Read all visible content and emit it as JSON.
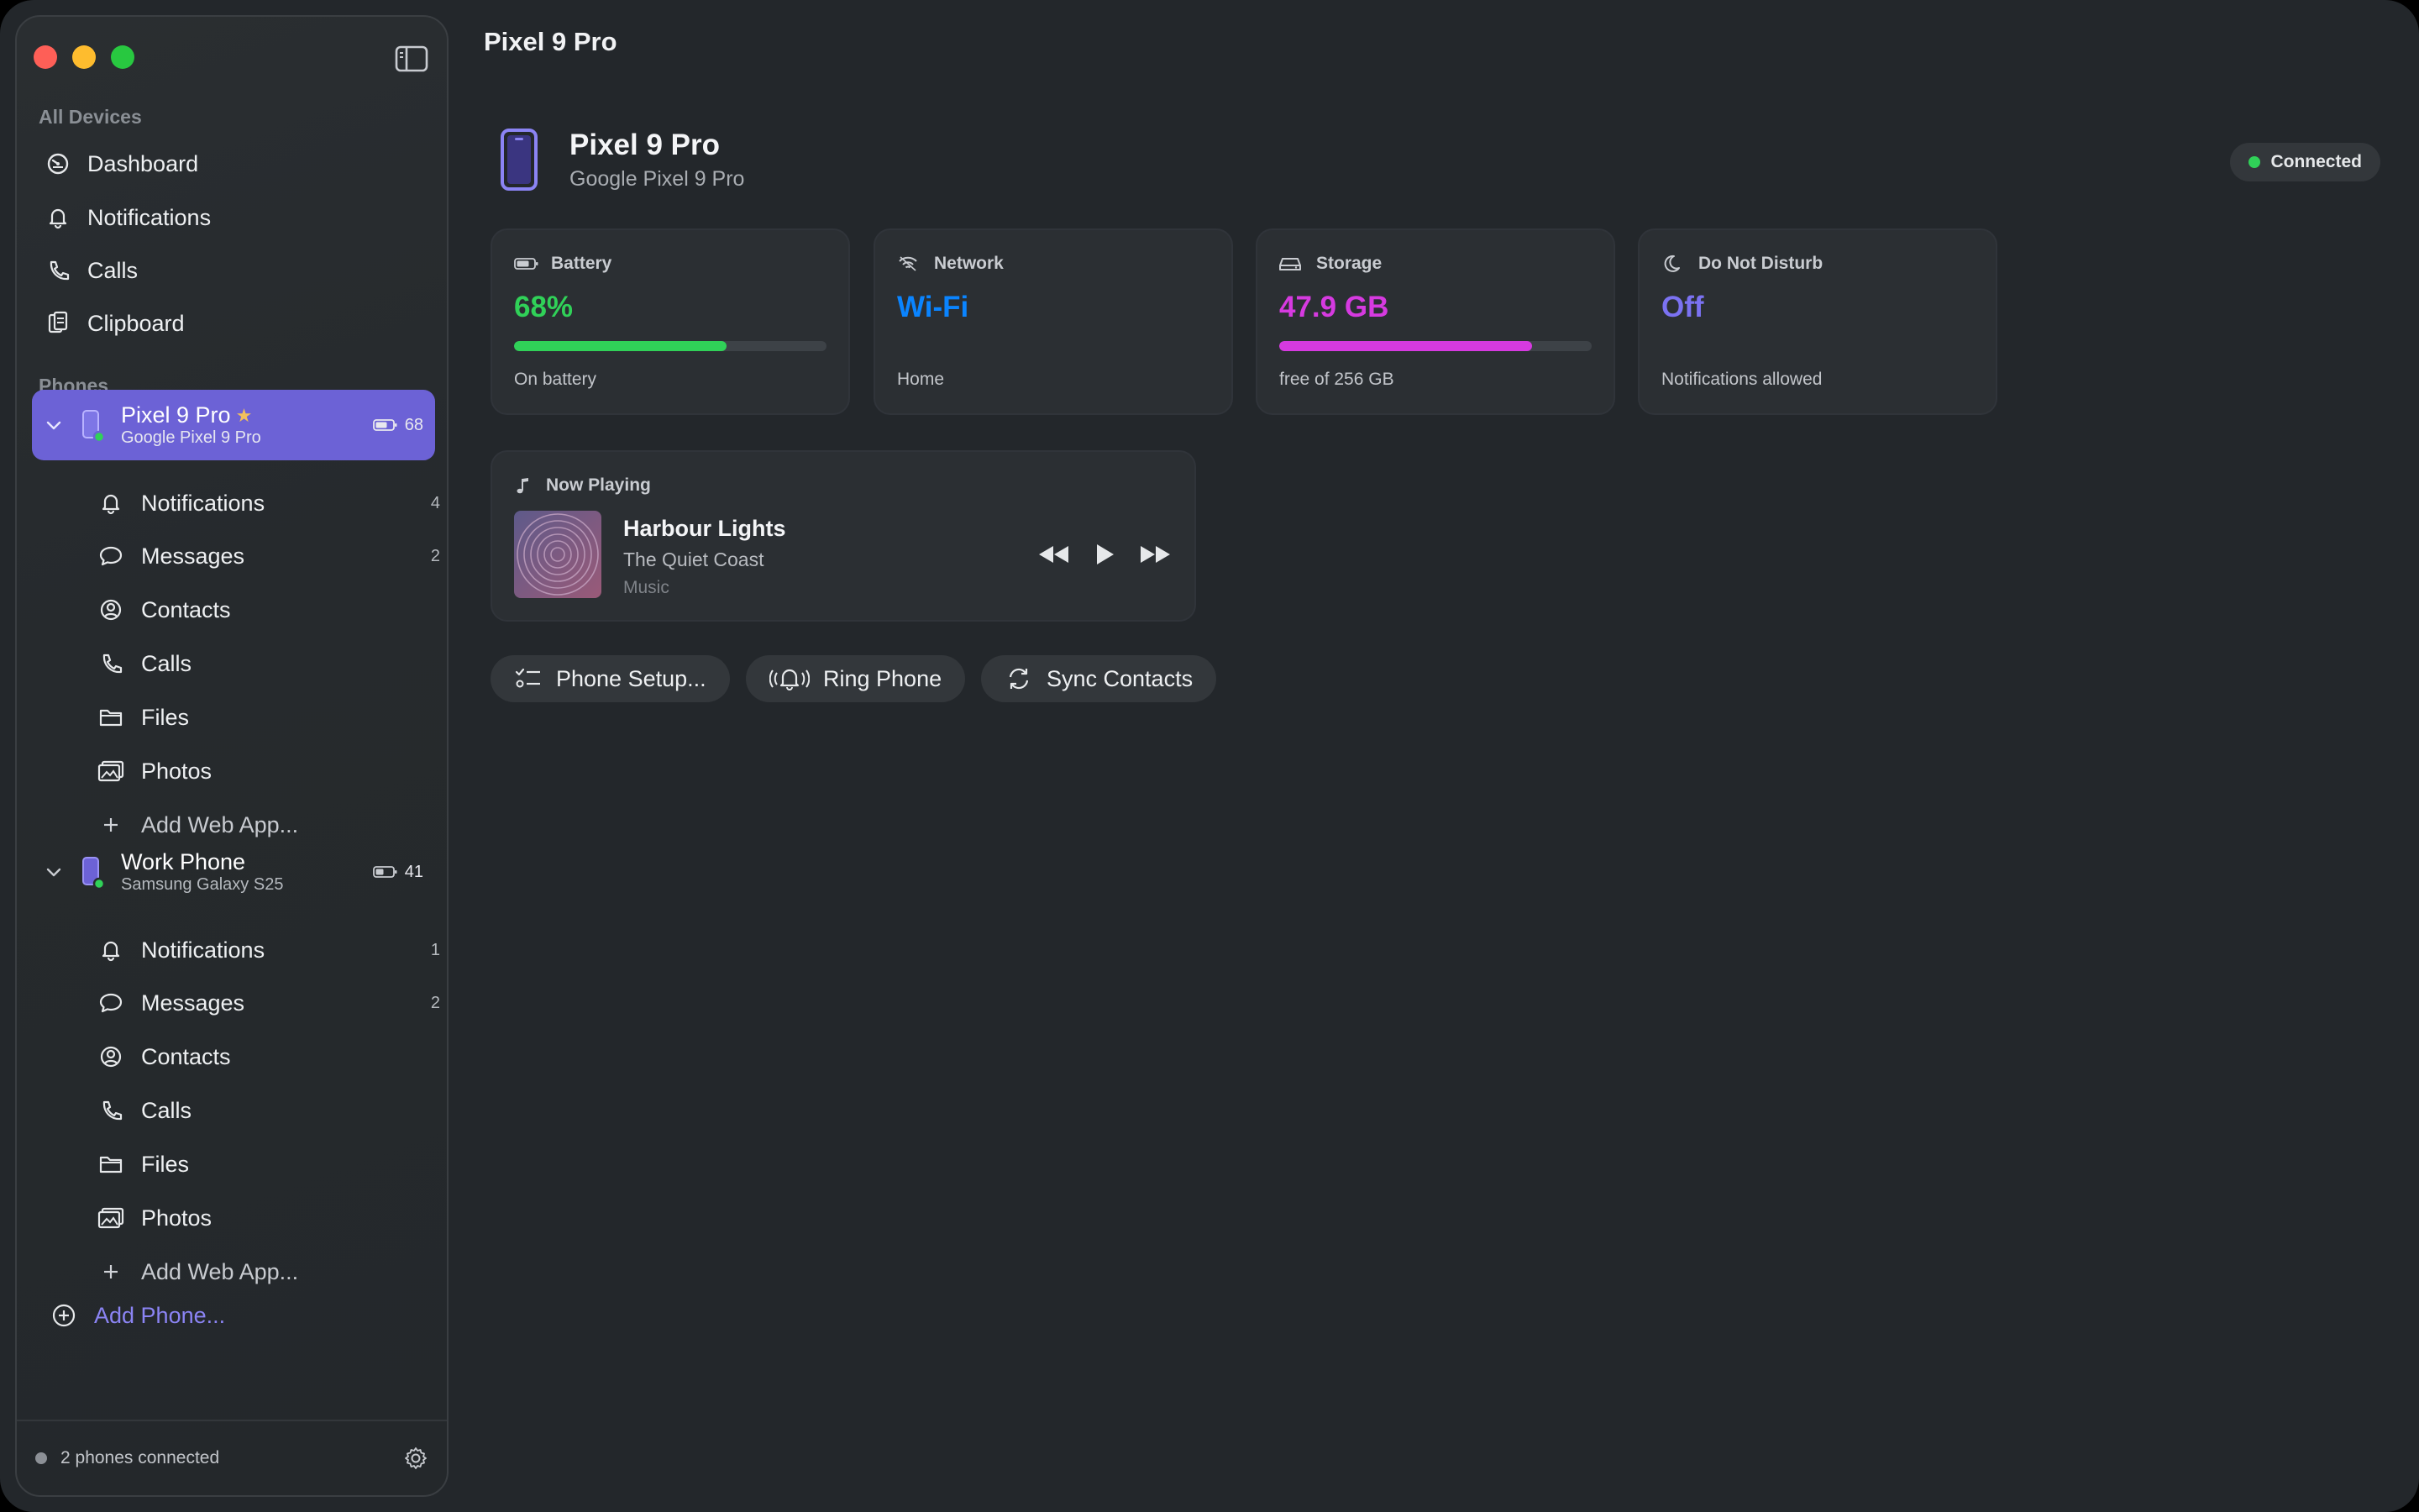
{
  "window": {
    "title": "Pixel 9 Pro"
  },
  "sidebar": {
    "all_devices_label": "All Devices",
    "top_items": [
      {
        "label": "Dashboard",
        "icon": "dashboard-icon"
      },
      {
        "label": "Notifications",
        "icon": "bell-icon"
      },
      {
        "label": "Calls",
        "icon": "phone-icon"
      },
      {
        "label": "Clipboard",
        "icon": "clipboard-icon"
      }
    ],
    "phones_label": "Phones",
    "phones": [
      {
        "name": "Pixel 9 Pro",
        "model": "Google Pixel 9 Pro",
        "battery": "68",
        "favorite": true,
        "selected": true,
        "items": [
          {
            "label": "Notifications",
            "count": "4"
          },
          {
            "label": "Messages",
            "count": "2"
          },
          {
            "label": "Contacts",
            "count": ""
          },
          {
            "label": "Calls",
            "count": ""
          },
          {
            "label": "Files",
            "count": ""
          },
          {
            "label": "Photos",
            "count": ""
          },
          {
            "label": "Add Web App...",
            "count": ""
          }
        ]
      },
      {
        "name": "Work Phone",
        "model": "Samsung Galaxy S25",
        "battery": "41",
        "favorite": false,
        "selected": false,
        "items": [
          {
            "label": "Notifications",
            "count": "1"
          },
          {
            "label": "Messages",
            "count": "2"
          },
          {
            "label": "Contacts",
            "count": ""
          },
          {
            "label": "Calls",
            "count": ""
          },
          {
            "label": "Files",
            "count": ""
          },
          {
            "label": "Photos",
            "count": ""
          },
          {
            "label": "Add Web App...",
            "count": ""
          }
        ]
      }
    ],
    "add_phone_label": "Add Phone...",
    "footer_status": "2 phones connected"
  },
  "device": {
    "name": "Pixel 9 Pro",
    "model": "Google Pixel 9 Pro",
    "status": "Connected"
  },
  "cards": {
    "battery": {
      "title": "Battery",
      "value": "68%",
      "sub": "On battery",
      "level": 0.68,
      "color": "#30d158"
    },
    "network": {
      "title": "Network",
      "value": "Wi-Fi",
      "sub": "Home",
      "color": "#0a84ff"
    },
    "storage": {
      "title": "Storage",
      "value": "47.9 GB",
      "sub": "free of 256 GB",
      "level": 0.81,
      "color": "#d63ae0"
    },
    "dnd": {
      "title": "Do Not Disturb",
      "value": "Off",
      "sub": "Notifications allowed",
      "color": "#7b72f2"
    }
  },
  "now_playing": {
    "label": "Now Playing",
    "title": "Harbour Lights",
    "artist": "The Quiet Coast",
    "source": "Music"
  },
  "actions": {
    "setup": "Phone Setup...",
    "ring": "Ring Phone",
    "sync": "Sync Contacts"
  },
  "colors": {
    "accent": "#6c62d6",
    "link": "#8b84f4"
  }
}
